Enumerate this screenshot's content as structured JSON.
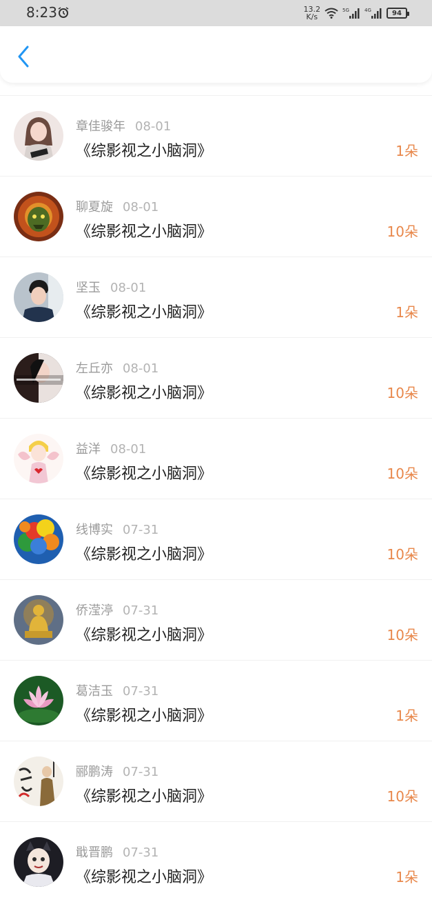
{
  "status_bar": {
    "time": "8:23",
    "net_speed_value": "13.2",
    "net_speed_unit": "K/s",
    "battery": "94",
    "icons": [
      "alarm-icon",
      "wifi-icon",
      "signal-5g-icon",
      "signal-4g-icon",
      "battery-icon"
    ]
  },
  "header": {
    "back_icon": "chevron-left-icon",
    "accent_color": "#2196f3"
  },
  "colors": {
    "amount": "#e8874a",
    "name": "#9a9a9a",
    "date": "#b3b3b3",
    "title": "#222222"
  },
  "list": {
    "items": [
      {
        "name": "章佳骏年",
        "date": "08-01",
        "title": "《综影视之小脑洞》",
        "amount": "1朵"
      },
      {
        "name": "聊夏旋",
        "date": "08-01",
        "title": "《综影视之小脑洞》",
        "amount": "10朵"
      },
      {
        "name": "坚玉",
        "date": "08-01",
        "title": "《综影视之小脑洞》",
        "amount": "1朵"
      },
      {
        "name": "左丘亦",
        "date": "08-01",
        "title": "《综影视之小脑洞》",
        "amount": "10朵"
      },
      {
        "name": "益洋",
        "date": "08-01",
        "title": "《综影视之小脑洞》",
        "amount": "10朵"
      },
      {
        "name": "线博实",
        "date": "07-31",
        "title": "《综影视之小脑洞》",
        "amount": "10朵"
      },
      {
        "name": "侨滢渟",
        "date": "07-31",
        "title": "《综影视之小脑洞》",
        "amount": "10朵"
      },
      {
        "name": "葛洁玉",
        "date": "07-31",
        "title": "《综影视之小脑洞》",
        "amount": "1朵"
      },
      {
        "name": "郦鹏涛",
        "date": "07-31",
        "title": "《综影视之小脑洞》",
        "amount": "10朵"
      },
      {
        "name": "戢晋鹏",
        "date": "07-31",
        "title": "《综影视之小脑洞》",
        "amount": "1朵"
      }
    ]
  }
}
